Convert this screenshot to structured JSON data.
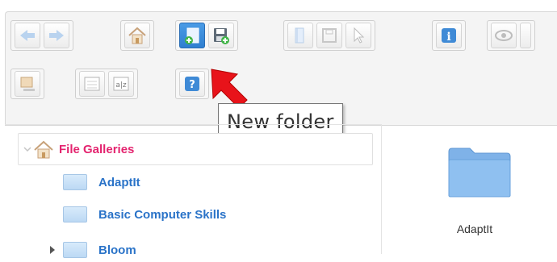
{
  "toolbar": {
    "buttons": [
      {
        "name": "back-button",
        "icon": "left-arrow-icon"
      },
      {
        "name": "forward-button",
        "icon": "right-arrow-icon"
      },
      {
        "name": "home-button",
        "icon": "home-icon"
      },
      {
        "name": "new-folder-button",
        "icon": "new-folder-icon",
        "active": true
      },
      {
        "name": "save-button",
        "icon": "save-icon"
      },
      {
        "name": "book-button",
        "icon": "book-icon"
      },
      {
        "name": "save-disabled-button",
        "icon": "floppy-icon"
      },
      {
        "name": "select-button",
        "icon": "cursor-icon"
      },
      {
        "name": "info-button",
        "icon": "info-icon"
      },
      {
        "name": "preview-button",
        "icon": "eye-icon"
      },
      {
        "name": "rename-button",
        "icon": "rename-icon"
      },
      {
        "name": "list-view-button",
        "icon": "list-icon"
      },
      {
        "name": "sort-button",
        "icon": "az-icon"
      },
      {
        "name": "help-button",
        "icon": "help-icon"
      }
    ],
    "accent_color": "#2f7fd0"
  },
  "tooltip": {
    "text": "New folder"
  },
  "tree": {
    "root_label": "File Galleries",
    "root_color": "#e4246f",
    "items": [
      {
        "label": "AdaptIt"
      },
      {
        "label": "Basic Computer Skills"
      },
      {
        "label": "Bloom"
      }
    ]
  },
  "content": {
    "folder_label": "AdaptIt"
  }
}
